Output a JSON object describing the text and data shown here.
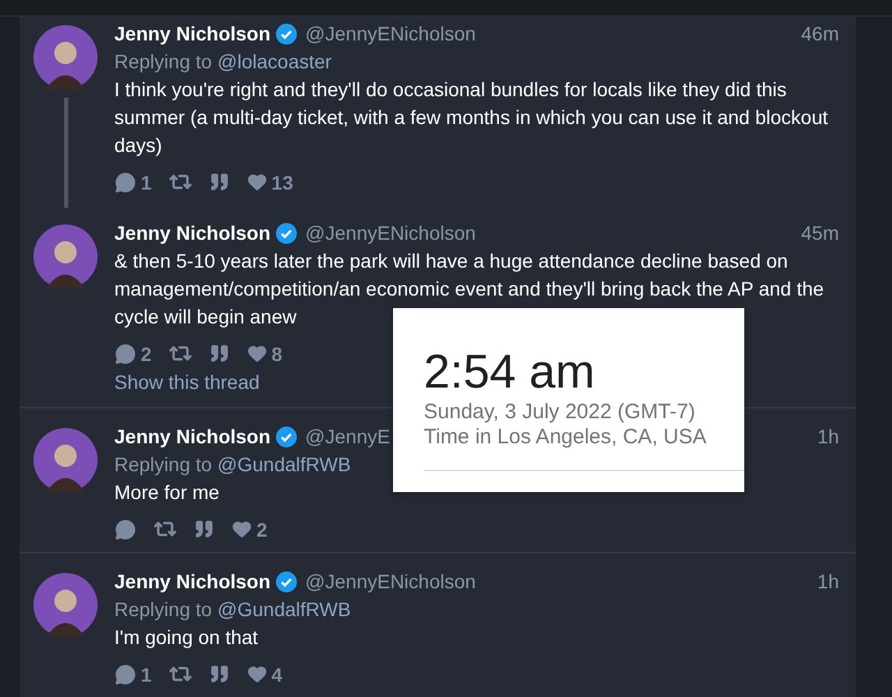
{
  "tweets": [
    {
      "name": "Jenny Nicholson",
      "verified": true,
      "handle": "@JennyENicholson",
      "time": "46m",
      "replying_label": "Replying to",
      "reply_to": "@lolacoaster",
      "text": "I think you're right and they'll do occasional bundles for locals like they did this summer (a multi-day ticket, with a few months in which you can use it and blockout days)",
      "replies": "1",
      "likes": "13",
      "connected_below": true
    },
    {
      "name": "Jenny Nicholson",
      "verified": true,
      "handle": "@JennyENicholson",
      "time": "45m",
      "text": "& then 5-10 years later the park will have a huge attendance decline based on management/competition/an economic event and they'll bring back the AP and the cycle will begin anew",
      "replies": "2",
      "likes": "8",
      "connected_below": false,
      "thread_link": "Show this thread"
    },
    {
      "name": "Jenny Nicholson",
      "verified": true,
      "handle": "@JennyE",
      "time": "1h",
      "replying_label": "Replying to",
      "reply_to": "@GundalfRWB",
      "text": "More for me",
      "likes": "2",
      "connected_below": false
    },
    {
      "name": "Jenny Nicholson",
      "verified": true,
      "handle": "@JennyENicholson",
      "time": "1h",
      "replying_label": "Replying to",
      "reply_to": "@GundalfRWB",
      "text": "I'm going on that",
      "replies": "1",
      "likes": "4",
      "connected_below": false
    }
  ],
  "time_popup": {
    "time": "2:54 am",
    "date": "Sunday, 3 July 2022 (GMT-7)",
    "location": "Time in Los Angeles, CA, USA"
  }
}
